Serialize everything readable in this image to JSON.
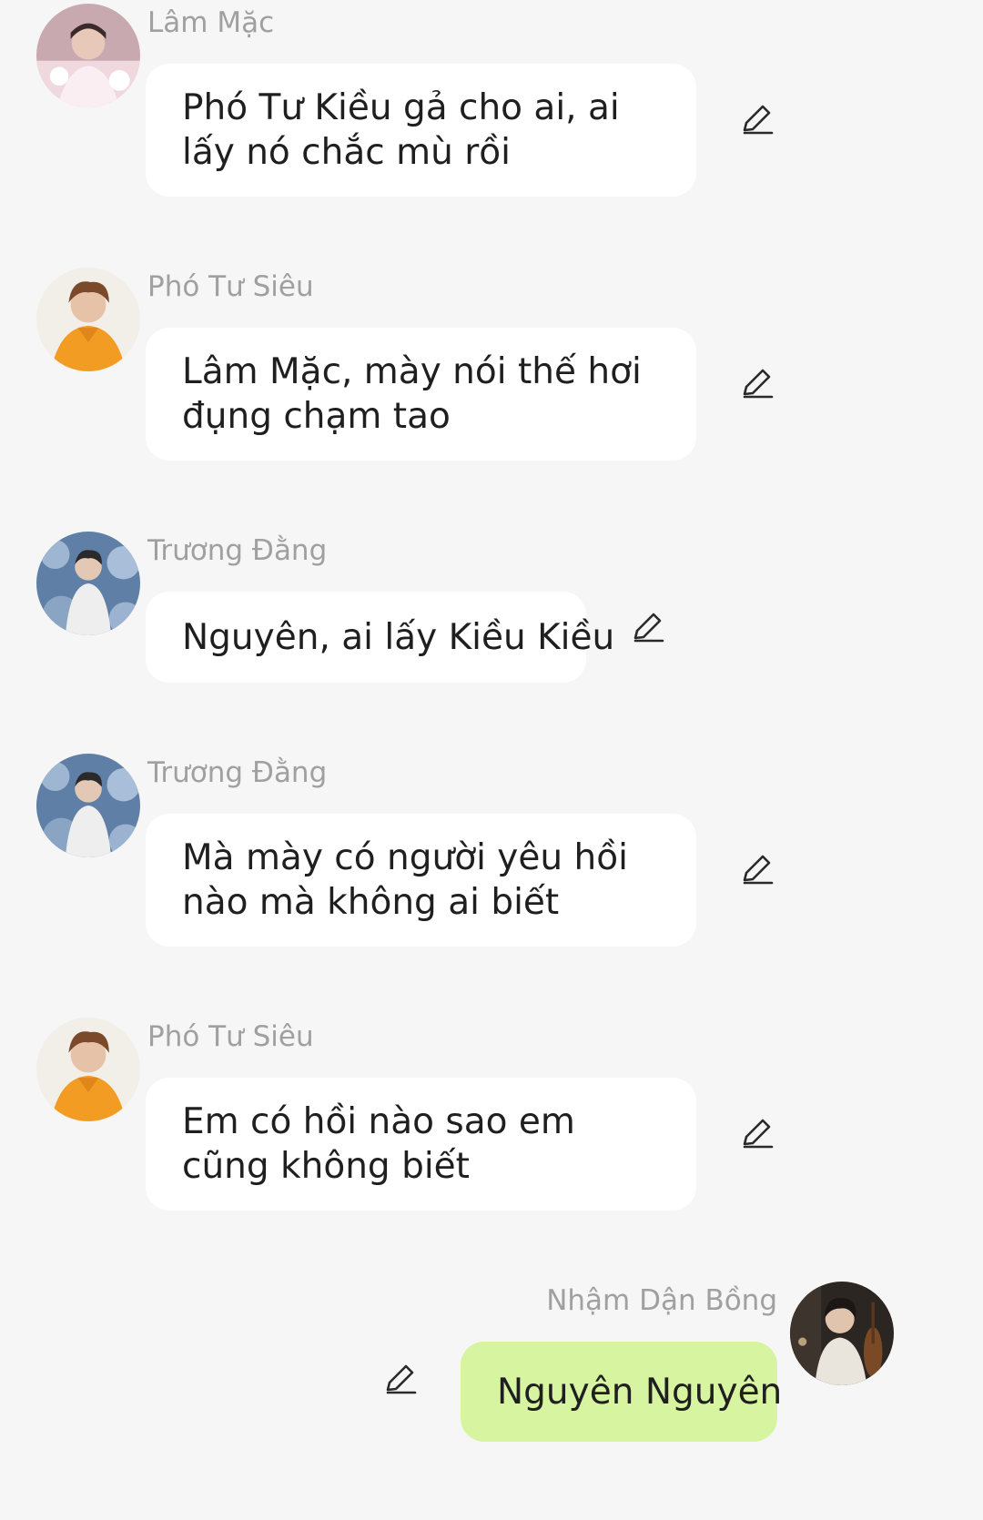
{
  "messages": [
    {
      "sender": "Lâm Mặc",
      "text": "Phó Tư Kiều gả cho ai, ai lấy nó chắc mù rồi",
      "avatar_icon": "avatar-lam-mac",
      "own": false
    },
    {
      "sender": "Phó Tư Siêu",
      "text": "Lâm Mặc, mày nói thế hơi đụng chạm tao",
      "avatar_icon": "avatar-pho-tu-sieu",
      "own": false
    },
    {
      "sender": "Trương Đằng",
      "text": "Nguyên, ai lấy Kiều Kiều",
      "avatar_icon": "avatar-truong-dang",
      "own": false
    },
    {
      "sender": "Trương Đằng",
      "text": "Mà mày có người yêu hồi nào mà không ai biết",
      "avatar_icon": "avatar-truong-dang",
      "own": false
    },
    {
      "sender": "Phó Tư Siêu",
      "text": "Em có hồi nào sao em cũng không biết",
      "avatar_icon": "avatar-pho-tu-sieu",
      "own": false
    },
    {
      "sender": "Nhậm Dận Bồng",
      "text": "Nguyên Nguyên",
      "avatar_icon": "avatar-nham-dan-bong",
      "own": true
    }
  ],
  "colors": {
    "background": "#f6f6f6",
    "bubble_incoming": "#ffffff",
    "bubble_outgoing": "#d7f4a0",
    "sender_name": "#a0a0a0",
    "message_text": "#1f1f1f",
    "edit_icon": "#2a2a2a"
  },
  "icons": {
    "edit": "pencil-edit-icon"
  }
}
